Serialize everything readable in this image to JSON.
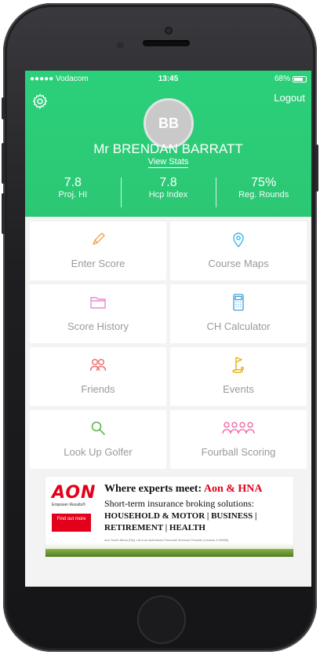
{
  "status_bar": {
    "carrier": "●●●●● Vodacom",
    "time": "13:45",
    "battery": "68%"
  },
  "header": {
    "logout_label": "Logout",
    "avatar_initials": "BB",
    "user_name": "Mr BRENDAN BARRATT",
    "view_stats_label": "View Stats",
    "stats": [
      {
        "value": "7.8",
        "label": "Proj. HI"
      },
      {
        "value": "7.8",
        "label": "Hcp Index"
      },
      {
        "value": "75%",
        "label": "Reg. Rounds"
      }
    ]
  },
  "menu": [
    {
      "label": "Enter Score",
      "icon": "pencil-icon",
      "color": "#f0a24a"
    },
    {
      "label": "Course Maps",
      "icon": "map-pin-icon",
      "color": "#3fb7e8"
    },
    {
      "label": "Score History",
      "icon": "folder-icon",
      "color": "#e98ad6"
    },
    {
      "label": "CH Calculator",
      "icon": "calculator-icon",
      "color": "#3a9fd8"
    },
    {
      "label": "Friends",
      "icon": "friends-icon",
      "color": "#ef6b6b"
    },
    {
      "label": "Events",
      "icon": "golf-flag-icon",
      "color": "#e8b00c"
    },
    {
      "label": "Look Up Golfer",
      "icon": "search-icon",
      "color": "#5ab84c"
    },
    {
      "label": "Fourball Scoring",
      "icon": "fourball-icon",
      "color": "#ef5fa1"
    }
  ],
  "ad": {
    "logo": "AON",
    "logo_tag": "Empower Results®",
    "button": "Find out more",
    "title_prefix": "Where experts meet: ",
    "title_highlight": "Aon & HNA",
    "line2": "Short-term insurance broking solutions:",
    "line3": "HOUSEHOLD & MOTOR | BUSINESS |",
    "line4": "RETIREMENT | HEALTH",
    "fine_print": "Aon South Africa (Pty) Ltd is an Authorised Financial Services Provider (License # 20555)"
  },
  "colors": {
    "header_green": "#2cc774",
    "ad_red": "#e2001a"
  }
}
